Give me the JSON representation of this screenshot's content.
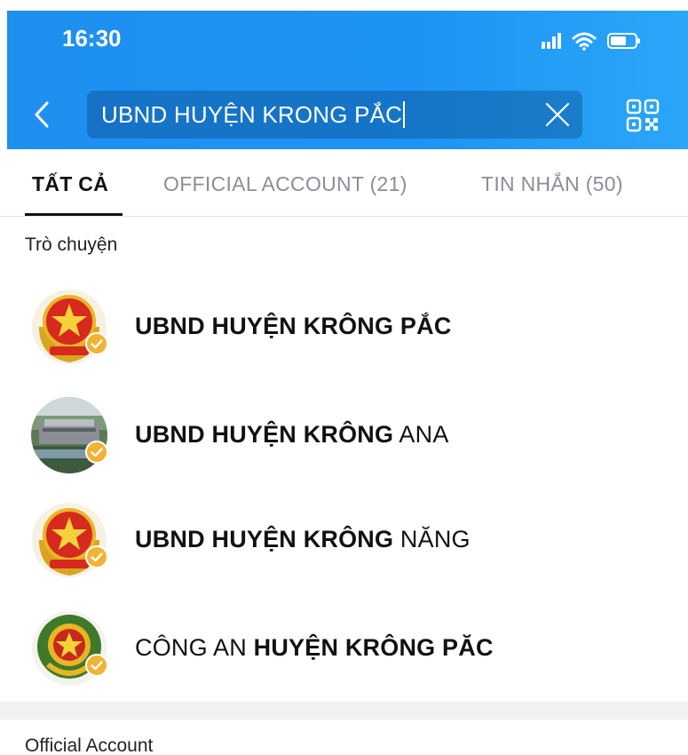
{
  "status_bar": {
    "time": "16:30"
  },
  "search": {
    "query": "UBND HUYỆN KRONG PẮC"
  },
  "tabs": [
    {
      "label": "TẤT CẢ",
      "active": true
    },
    {
      "label": "OFFICIAL ACCOUNT (21)",
      "active": false
    },
    {
      "label": "TIN NHẮN (50)",
      "active": false
    }
  ],
  "sections": {
    "chats_title": "Trò chuyện",
    "official_title": "Official Account"
  },
  "results": [
    {
      "bold": "UBND HUYỆN KRÔNG PẮC",
      "normal_before": "",
      "normal_after": "",
      "avatar": "national-emblem-icon"
    },
    {
      "bold": "UBND HUYỆN KRÔNG",
      "normal_before": "",
      "normal_after": " ANA",
      "avatar": "building-photo"
    },
    {
      "bold": "UBND HUYỆN KRÔNG",
      "normal_before": "",
      "normal_after": " NĂNG",
      "avatar": "national-emblem-icon"
    },
    {
      "bold": "HUYỆN KRÔNG PĂC",
      "normal_before": "CÔNG AN ",
      "normal_after": "",
      "avatar": "police-emblem-icon"
    }
  ],
  "colors": {
    "header": "#1f8ff0",
    "verified": "#f2b233",
    "emblem_red": "#d62a1e",
    "emblem_gold": "#e9b526"
  }
}
